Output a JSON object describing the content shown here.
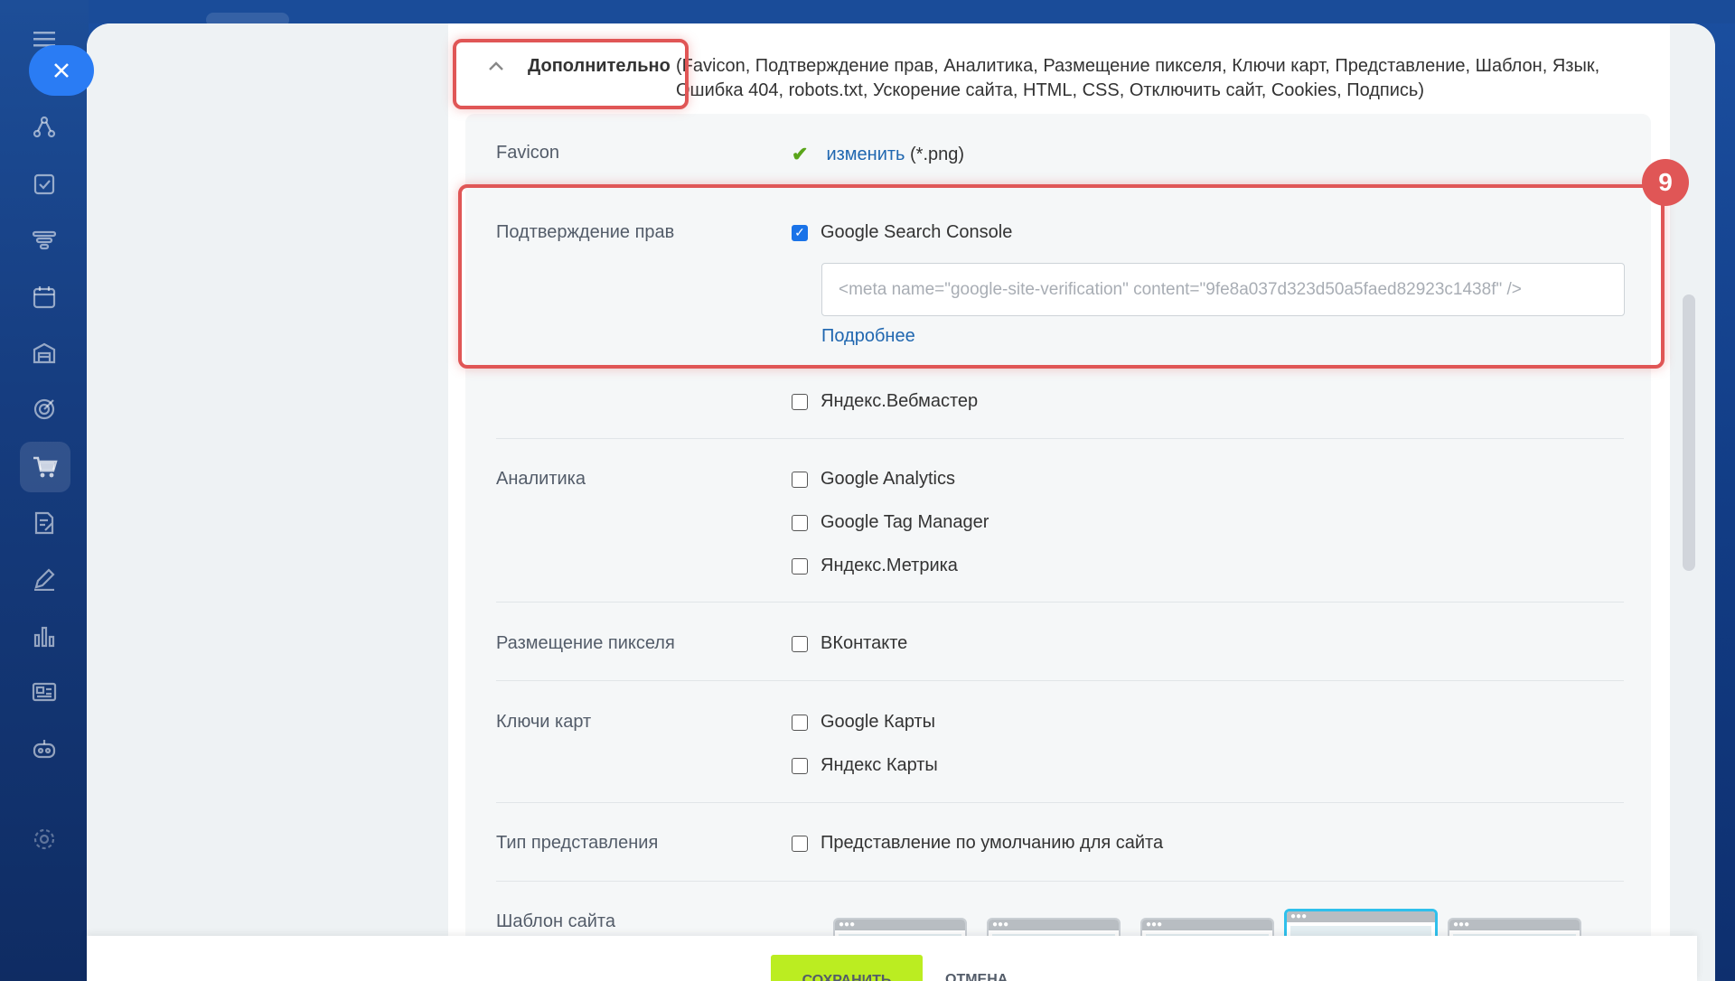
{
  "sidebar": {
    "icons": [
      "menu-icon",
      "flow-icon",
      "task-icon",
      "funnel-icon",
      "calendar-icon",
      "store-icon",
      "target-icon",
      "cart-icon",
      "doc-sign-icon",
      "pen-icon",
      "chart-icon",
      "card-icon",
      "robot-icon",
      "settings-icon"
    ]
  },
  "section": {
    "title": "Дополнительно",
    "links": "(Favicon,  Подтверждение прав,  Аналитика,  Размещение пикселя,  Ключи карт,  Представление,  Шаблон, Язык,  Ошибка 404,  robots.txt,  Ускорение сайта,  HTML,  CSS,  Отключить сайт,  Cookies,  Подпись)"
  },
  "badge": "9",
  "favicon": {
    "label": "Favicon",
    "change_link": "изменить",
    "ext": "(*.png)"
  },
  "verification": {
    "label": "Подтверждение прав",
    "google": "Google Search Console",
    "meta_placeholder": "<meta name=\"google-site-verification\" content=\"9fe8a037d323d50a5faed82923c1438f\" />",
    "more_link": "Подробнее",
    "yandex": "Яндекс.Вебмастер"
  },
  "analytics": {
    "label": "Аналитика",
    "options": [
      "Google Analytics",
      "Google Tag Manager",
      "Яндекс.Метрика"
    ]
  },
  "pixel": {
    "label": "Размещение пикселя",
    "option": "ВКонтакте"
  },
  "maps": {
    "label": "Ключи карт",
    "options": [
      "Google Карты",
      "Яндекс Карты"
    ]
  },
  "view": {
    "label": "Тип представления",
    "option": "Представление по умолчанию для сайта"
  },
  "template": {
    "label": "Шаблон сайта"
  },
  "footer": {
    "save": "СОХРАНИТЬ",
    "cancel": "ОТМЕНА"
  }
}
